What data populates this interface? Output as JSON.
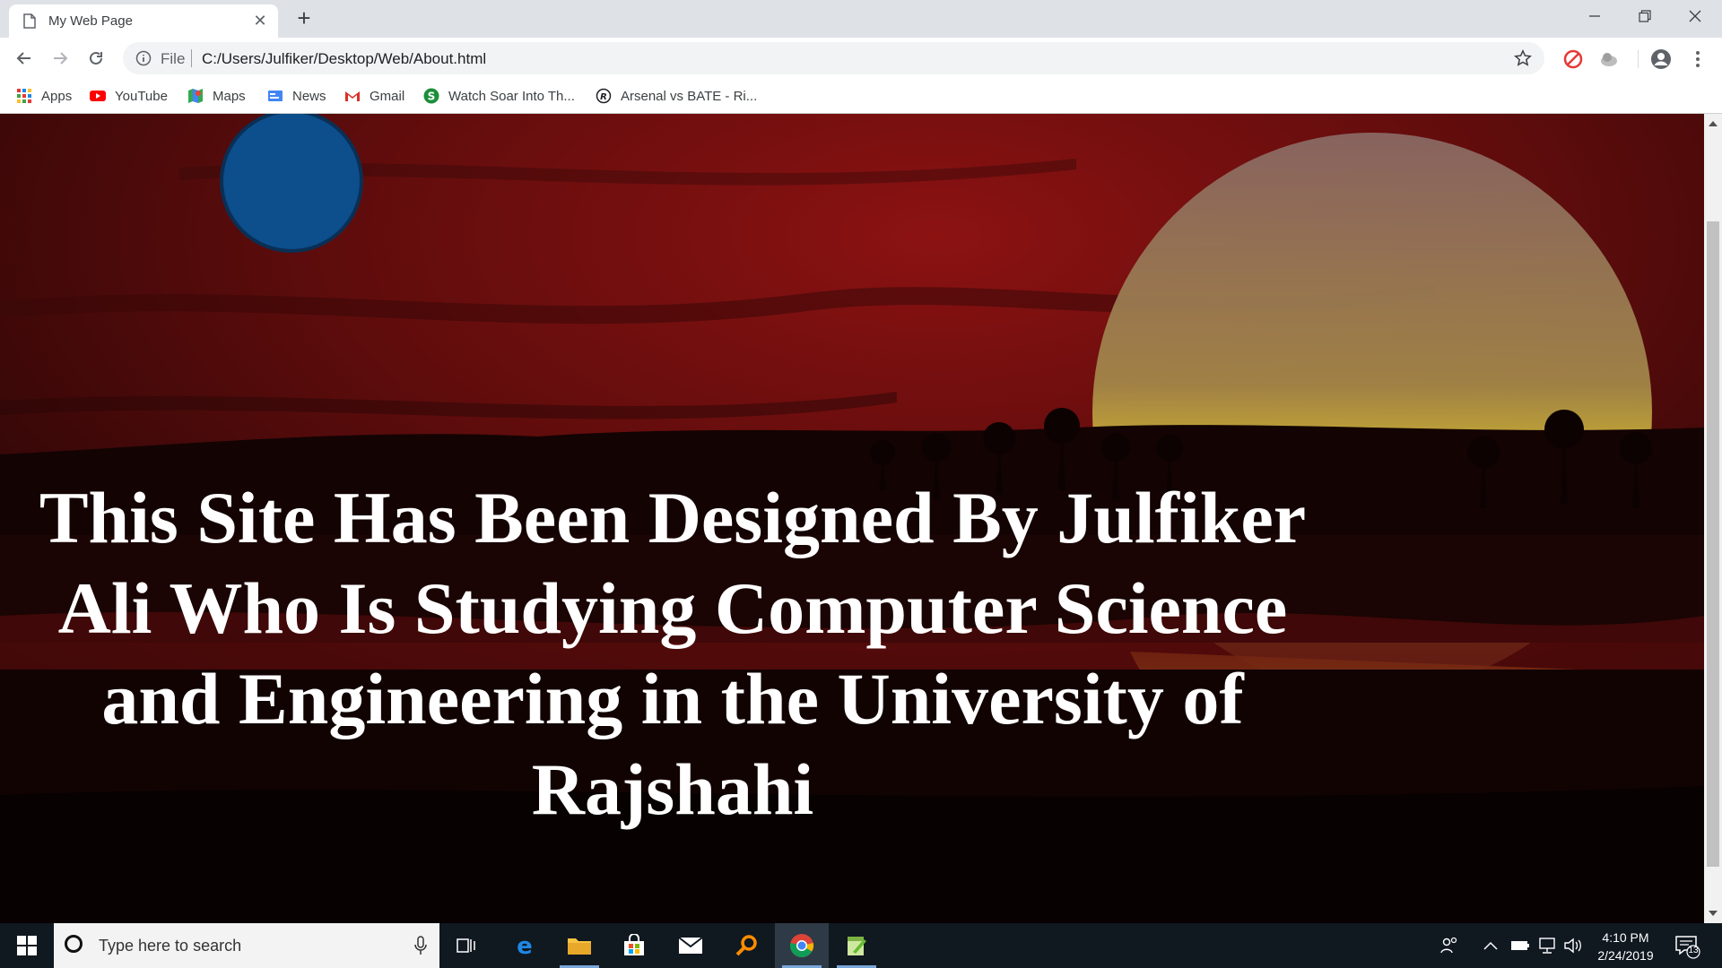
{
  "browser": {
    "tab": {
      "title": "My Web Page",
      "close_glyph": "✕"
    },
    "new_tab_glyph": "+",
    "window_controls": {
      "minimize_glyph": "—",
      "maximize_glyph": "❐",
      "close_glyph": "✕"
    },
    "address_bar": {
      "scheme_label": "File",
      "url": "C:/Users/Julfiker/Desktop/Web/About.html"
    },
    "bookmarks": [
      {
        "label": "Apps",
        "icon": "apps-grid-icon"
      },
      {
        "label": "YouTube",
        "icon": "youtube-icon"
      },
      {
        "label": "Maps",
        "icon": "maps-icon"
      },
      {
        "label": "News",
        "icon": "news-icon"
      },
      {
        "label": "Gmail",
        "icon": "gmail-icon"
      },
      {
        "label": "Watch Soar Into Th...",
        "icon": "green-s-icon"
      },
      {
        "label": "Arsenal vs BATE - Ri...",
        "icon": "registered-icon"
      }
    ]
  },
  "page": {
    "hero_text": "This Site Has Been Designed By Julfiker Ali Who Is Studying Computer Science and Engineering in the University of Rajshahi"
  },
  "taskbar": {
    "search_placeholder": "Type here to search",
    "clock": {
      "time": "4:10 PM",
      "date": "2/24/2019"
    },
    "notification_count": "13"
  },
  "colors": {
    "tab_strip": "#dee1e6",
    "omnibox": "#f1f3f4",
    "taskbar": "#101820",
    "hero_text": "#ffffff"
  }
}
